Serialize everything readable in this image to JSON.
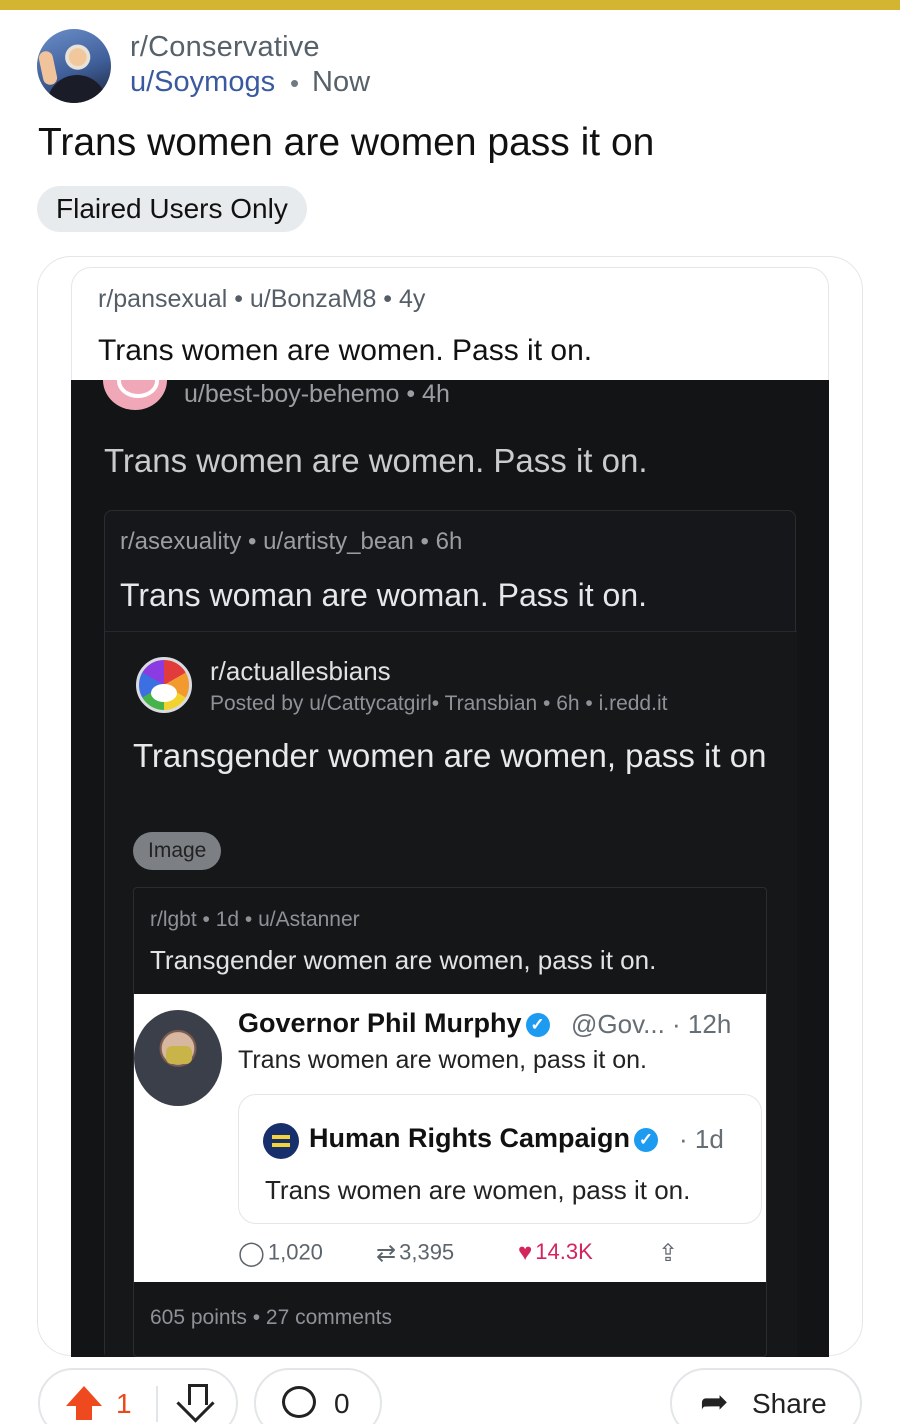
{
  "post": {
    "subreddit": "r/Conservative",
    "author": "u/Soymogs",
    "separator": "•",
    "time": "Now",
    "title": "Trans women are women pass it on",
    "flair": "Flaired Users Only"
  },
  "embedded": {
    "level1": {
      "meta": "r/pansexual • u/BonzaM8 • 4y",
      "title": "Trans women are women. Pass it on."
    },
    "level2": {
      "meta": "u/best-boy-behemo • 4h",
      "title": "Trans women are women. Pass it on."
    },
    "level3": {
      "meta": "r/asexuality • u/artisty_bean • 6h",
      "title": "Trans woman are woman. Pass it on."
    },
    "level4": {
      "subreddit": "r/actuallesbians",
      "posted_by": "Posted by u/Cattycatgirl• Transbian • 6h • i.redd.it",
      "title": "Transgender women are women, pass it on",
      "pill": "Image"
    },
    "level5": {
      "meta": "r/lgbt • 1d • u/Astanner",
      "title": "Transgender women are women, pass it on.",
      "footer": "605 points • 27 comments"
    },
    "tweet": {
      "name": "Governor Phil Murphy",
      "verified_glyph": "✓",
      "handle": "@Gov... · 12h",
      "text": "Trans women are women, pass it on.",
      "quote_name": "Human Rights Campaign",
      "quote_time": "· 1d",
      "quote_text": "Trans women are women, pass it on.",
      "replies": "1,020",
      "retweets": "3,395",
      "likes": "14.3K"
    }
  },
  "actions": {
    "upvotes": "1",
    "comments": "0",
    "share": "Share"
  },
  "colors": {
    "topbar": "#d4b531",
    "username": "#3a5a9f",
    "upvote": "#ef4a1f",
    "like": "#d4245c",
    "verified": "#1d9bf0"
  },
  "icons": [
    "avatar",
    "upvote-icon",
    "downvote-icon",
    "comment-icon",
    "share-icon",
    "verified-icon",
    "reply-icon",
    "retweet-icon",
    "heart-icon",
    "upload-icon"
  ]
}
